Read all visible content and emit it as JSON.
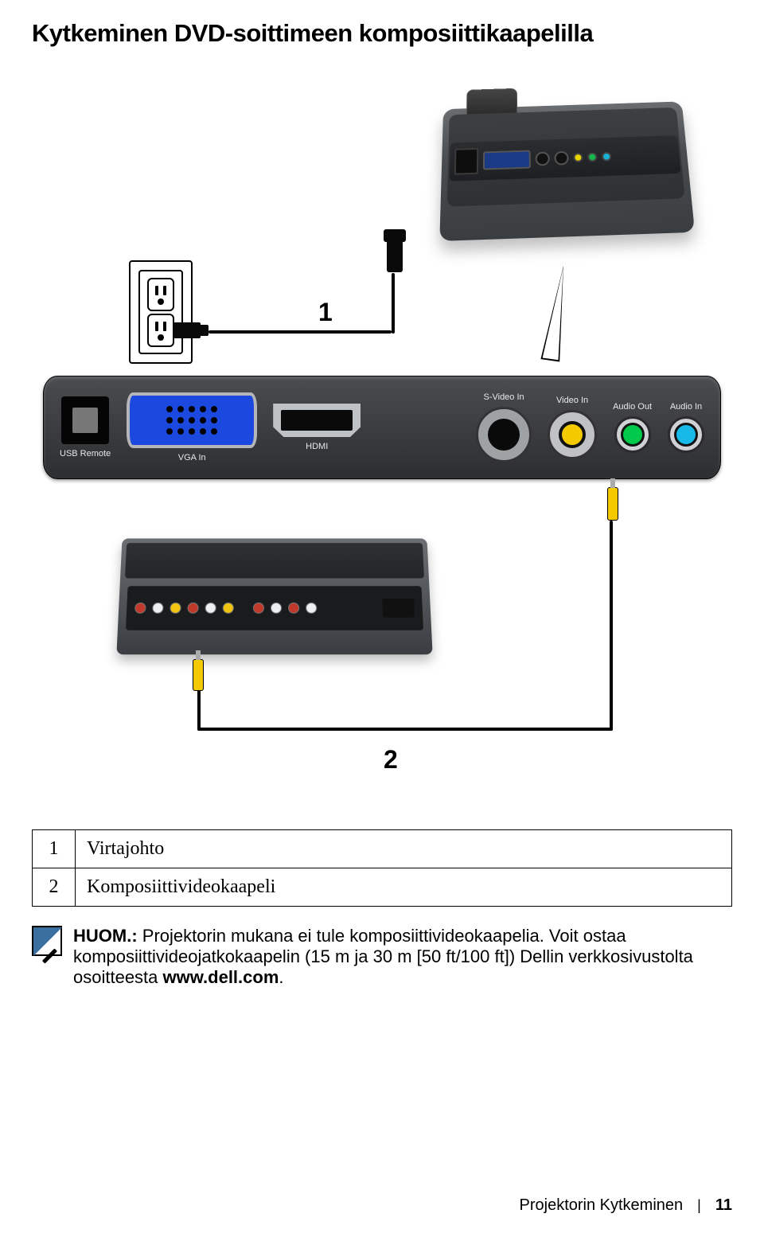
{
  "title": "Kytkeminen DVD-soittimeen komposiittikaapelilla",
  "diagram": {
    "callouts": {
      "one": "1",
      "two": "2"
    },
    "panel": {
      "usb_label": "USB Remote",
      "vga_label": "VGA In",
      "hdmi_label": "HDMI",
      "svideo_label": "S-Video In",
      "videoin_label": "Video In",
      "audioout_label": "Audio Out",
      "audioin_label": "Audio In"
    }
  },
  "legend": {
    "rows": [
      {
        "num": "1",
        "label": "Virtajohto"
      },
      {
        "num": "2",
        "label": "Komposiittivideokaapeli"
      }
    ]
  },
  "note": {
    "lead": "HUOM.:",
    "body_a": " Projektorin mukana ei tule komposiittivideokaapelia. Voit ostaa komposiittivideojatkokaapelin (15 m ja 30 m [50 ft/100 ft]) Dellin verkkosivustolta osoitteesta ",
    "link": "www.dell.com",
    "body_b": "."
  },
  "footer": {
    "section": "Projektorin Kytkeminen",
    "page": "11"
  }
}
